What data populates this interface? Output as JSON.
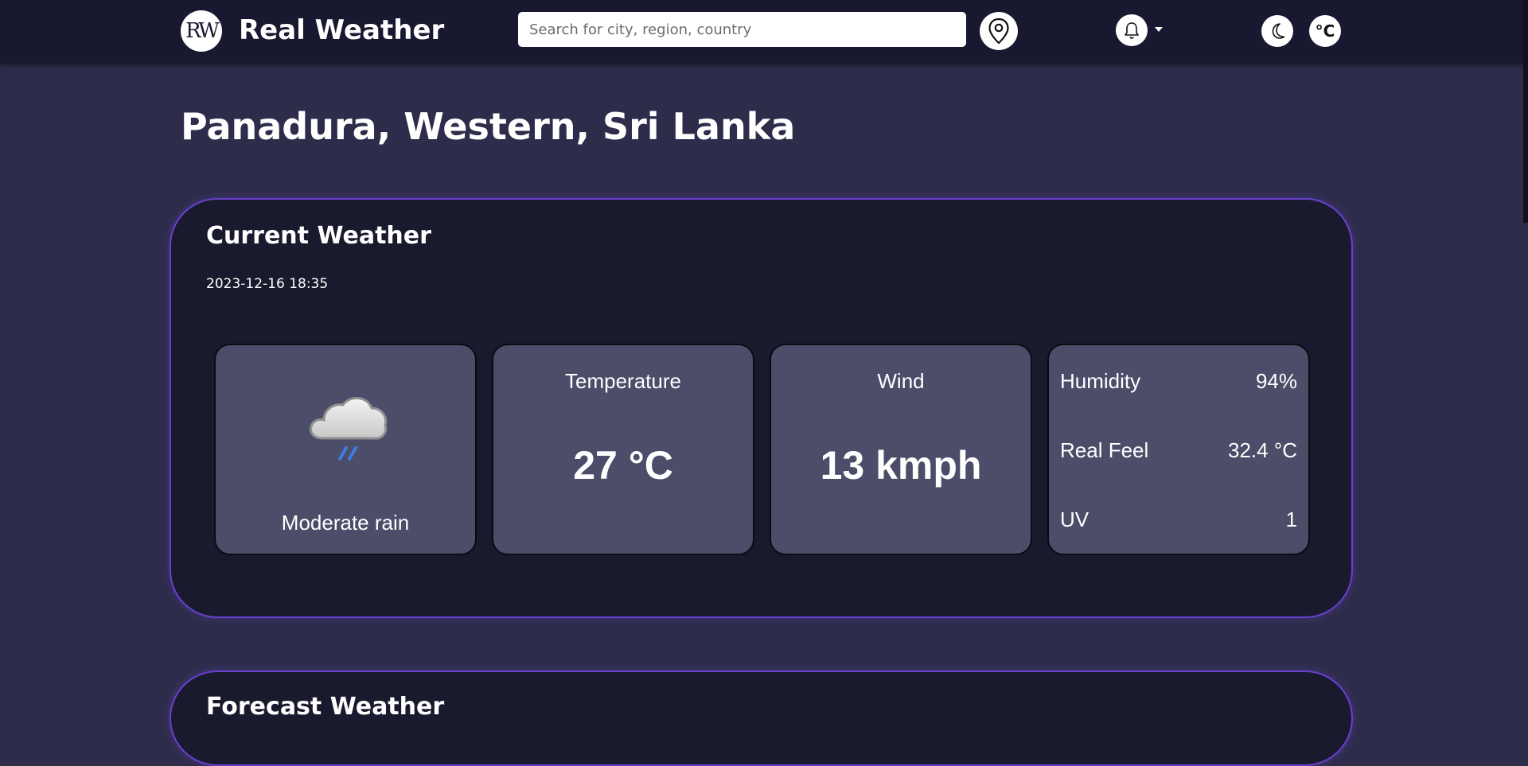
{
  "navbar": {
    "logo_text": "RW",
    "brand": "Real Weather",
    "search_placeholder": "Search for city, region, country",
    "icons": {
      "location": "map-pin-icon",
      "notifications": "bell-icon",
      "theme": "moon-icon",
      "units": "celsius-icon"
    },
    "units_label": "°C"
  },
  "location_title": "Panadura, Western, Sri Lanka",
  "current": {
    "title": "Current Weather",
    "timestamp": "2023-12-16 18:35",
    "condition": "Moderate rain",
    "condition_icon": "rain-cloud-icon",
    "temperature_label": "Temperature",
    "temperature_value": "27 °C",
    "wind_label": "Wind",
    "wind_value": "13 kmph",
    "stats": [
      {
        "label": "Humidity",
        "value": "94%"
      },
      {
        "label": "Real Feel",
        "value": "32.4 °C"
      },
      {
        "label": "UV",
        "value": "1"
      }
    ]
  },
  "forecast": {
    "title": "Forecast Weather"
  },
  "colors": {
    "page_bg": "#2d2d4b",
    "navbar_bg": "#181830",
    "card_bg": "#1a1a2e",
    "card_border": "#6a3fd0",
    "tile_bg": "#4b4d69"
  }
}
